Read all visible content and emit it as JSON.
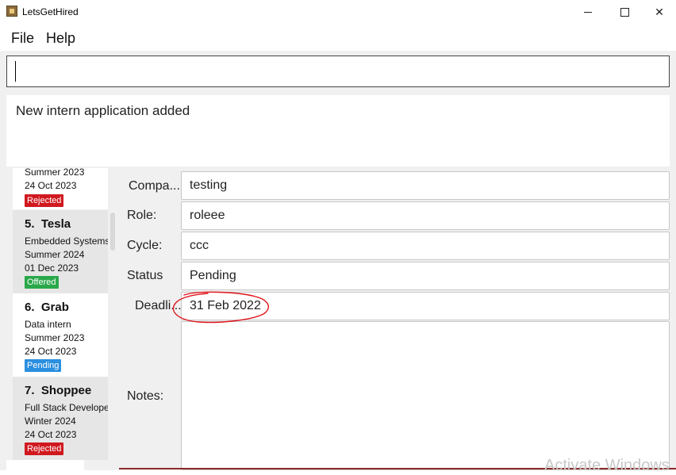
{
  "window": {
    "title": "LetsGetHired"
  },
  "menu": {
    "file": "File",
    "help": "Help"
  },
  "command": {
    "value": ""
  },
  "result": {
    "message": "New intern application added"
  },
  "list": {
    "top_partial": {
      "cycle": "Summer 2023",
      "deadline": "24 Oct 2023",
      "status": "Rejected"
    },
    "items": [
      {
        "index": "5.",
        "company": "Tesla",
        "role": "Embedded Systems",
        "cycle": "Summer 2024",
        "deadline": "01 Dec 2023",
        "status": "Offered"
      },
      {
        "index": "6.",
        "company": "Grab",
        "role": "Data intern",
        "cycle": "Summer 2023",
        "deadline": "24 Oct 2023",
        "status": "Pending"
      },
      {
        "index": "7.",
        "company": "Shoppee",
        "role": "Full Stack Develope",
        "cycle": "Winter 2024",
        "deadline": "24 Oct 2023",
        "status": "Rejected"
      }
    ]
  },
  "detail": {
    "company_label": "Compa...",
    "company_value": "testing",
    "role_label": "Role:",
    "role_value": "roleee",
    "cycle_label": "Cycle:",
    "cycle_value": "ccc",
    "status_label": "Status",
    "status_value": "Pending",
    "deadline_label": "Deadli...",
    "deadline_value": "31 Feb 2022",
    "notes_label": "Notes:",
    "notes_value": ""
  },
  "watermark": "Activate Windows",
  "colors": {
    "rejected": "#d0191f",
    "offered": "#2aa84a",
    "pending": "#2b8fe0",
    "annotation": "#e0141c"
  }
}
